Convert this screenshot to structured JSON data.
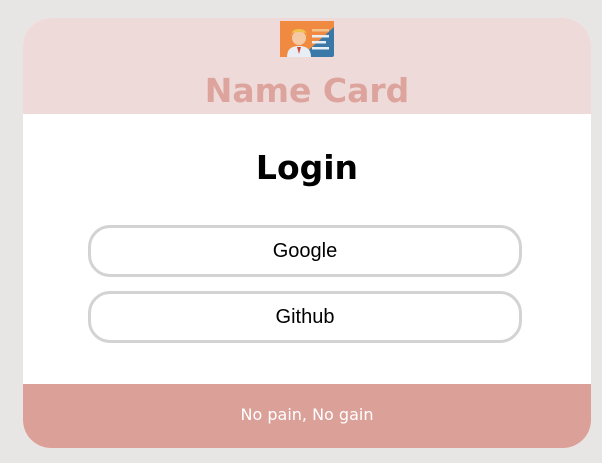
{
  "header": {
    "logo_icon": "id-card-icon",
    "title": "Name Card"
  },
  "login": {
    "title": "Login",
    "google_label": "Google",
    "github_label": "Github"
  },
  "footer": {
    "text": "No pain, No gain"
  },
  "colors": {
    "page_background": "#e7e6e5",
    "header_background": "#efdada",
    "brand_title": "#dca49c",
    "footer_background": "#dba199",
    "button_border": "#d3d3d3"
  }
}
